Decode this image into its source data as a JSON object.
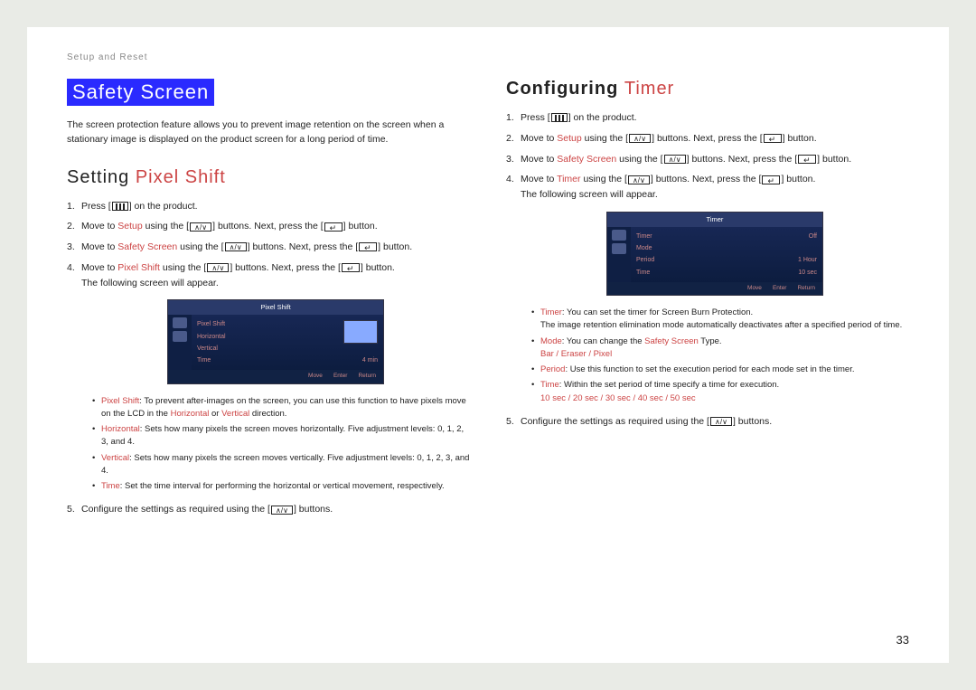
{
  "breadcrumb": "Setup and Reset",
  "page_number": "33",
  "left": {
    "h1": "Safety Screen",
    "intro": "The screen protection feature allows you to prevent image retention on the screen when a stationary image is displayed on the product screen for a long period of time.",
    "h2_plain": "Setting ",
    "h2_accent": "Pixel Shift",
    "steps": {
      "s1a": "Press [",
      "s1b": "] on the product.",
      "s2a": "Move to ",
      "s2m": "Setup",
      "s2b": " using the [",
      "s2c": "] buttons. Next, press the [",
      "s2d": "] button.",
      "s3a": "Move to ",
      "s3m": "Safety Screen",
      "s3b": " using the [",
      "s3c": "] buttons. Next, press the [",
      "s3d": "] button.",
      "s4a": "Move to ",
      "s4m": "Pixel Shift",
      "s4b": " using the [",
      "s4c": "] buttons. Next, press the [",
      "s4d": "] button.",
      "s4e": "The following screen will appear.",
      "s5a": "Configure the settings as required using the [",
      "s5b": "] buttons."
    },
    "osd_title": "Pixel Shift",
    "osd_rows": [
      {
        "lab": "Pixel Shift",
        "val": ""
      },
      {
        "lab": "Horizontal",
        "val": ""
      },
      {
        "lab": "Vertical",
        "val": ""
      },
      {
        "lab": "Time",
        "val": "4  min"
      }
    ],
    "osd_foot": [
      "Move",
      "Enter",
      "Return"
    ],
    "bullets_ps": {
      "b1a": "Pixel Shift",
      "b1b": ": To prevent after-images on the screen, you can use this function to have pixels move on the LCD in the ",
      "b1h": "Horizontal",
      "b1or": " or ",
      "b1v": "Vertical",
      "b1c": " direction.",
      "b2a": "Horizontal",
      "b2b": ": Sets how many pixels the screen moves horizontally. Five adjustment levels: 0, 1, 2, 3, and 4.",
      "b3a": "Vertical",
      "b3b": ": Sets how many pixels the screen moves vertically. Five adjustment levels: 0, 1, 2, 3, and 4.",
      "b4a": "Time",
      "b4b": ": Set the time interval for performing the horizontal or vertical movement, respectively."
    }
  },
  "right": {
    "h2_bold": "Configuring ",
    "h2_accent": "Timer",
    "steps": {
      "s1a": "Press [",
      "s1b": "] on the product.",
      "s2a": "Move to ",
      "s2m": "Setup",
      "s2b": " using the [",
      "s2c": "] buttons. Next, press the [",
      "s2d": "] button.",
      "s3a": "Move to ",
      "s3m": "Safety Screen",
      "s3b": " using the [",
      "s3c": "] buttons. Next, press the [",
      "s3d": "] button.",
      "s4a": "Move to ",
      "s4m": "Timer",
      "s4b": " using the [",
      "s4c": "] buttons. Next, press the [",
      "s4d": "] button.",
      "s4e": "The following screen will appear.",
      "s5a": "Configure the settings as required using the [",
      "s5b": "] buttons."
    },
    "osd_title": "Timer",
    "osd_rows": [
      {
        "lab": "Timer",
        "val": "Off"
      },
      {
        "lab": "Mode",
        "val": ""
      },
      {
        "lab": "Period",
        "val": "1   Hour"
      },
      {
        "lab": "Time",
        "val": "10 sec"
      }
    ],
    "osd_foot": [
      "Move",
      "Enter",
      "Return"
    ],
    "bullets_tm": {
      "b1a": "Timer",
      "b1b": ": You can set the timer for Screen Burn Protection.",
      "b1c": "The image retention elimination mode automatically deactivates after a specified period of time.",
      "b2a": "Mode",
      "b2b": ": You can change the ",
      "b2m": "Safety Screen",
      "b2c": " Type.",
      "b2opts": "Bar / Eraser / Pixel",
      "b3a": "Period",
      "b3b": ": Use this function to set the execution period for each mode set in the timer.",
      "b4a": "Time",
      "b4b": ": Within the set period of time specify a time for execution.",
      "b4opts": "10 sec / 20 sec / 30 sec / 40 sec / 50 sec"
    }
  }
}
